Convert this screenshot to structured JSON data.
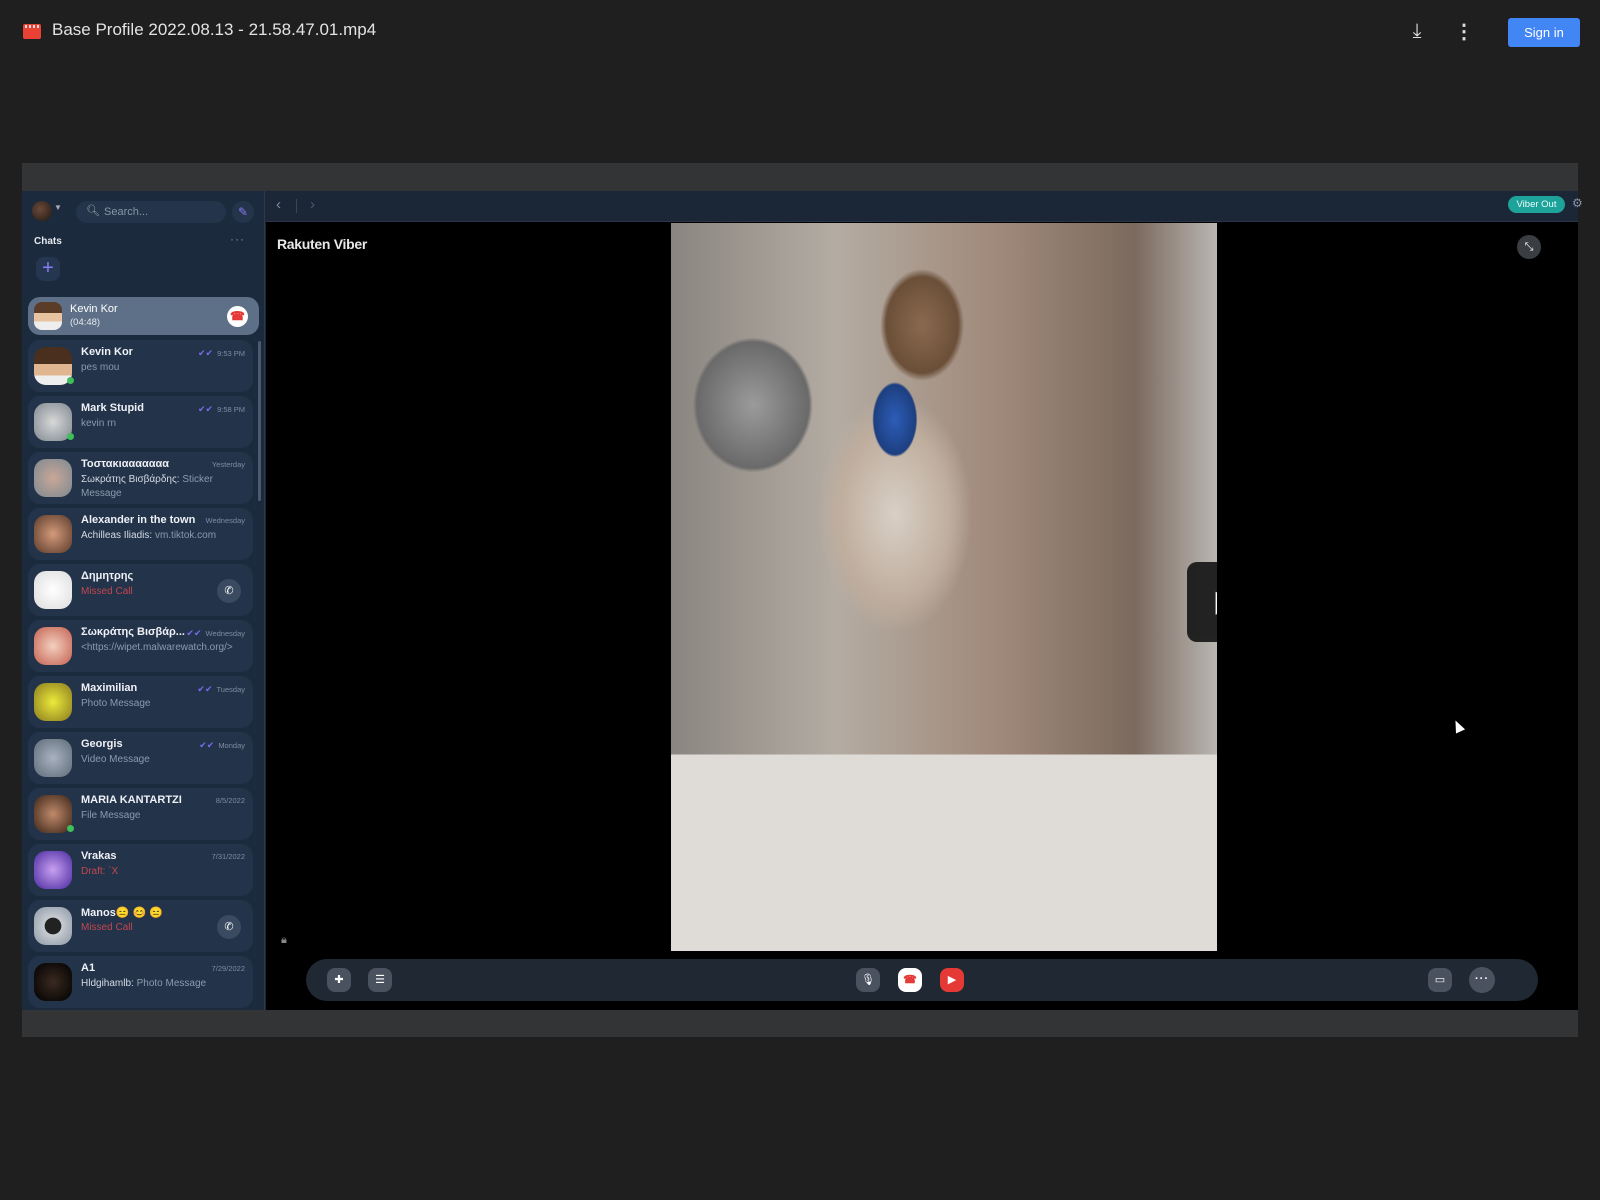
{
  "header": {
    "file_name": "Base Profile 2022.08.13 - 21.58.47.01.mp4",
    "download_label": "Download",
    "more_label": "More actions",
    "sign_in": "Sign in",
    "accent": "#4285f4"
  },
  "viber": {
    "search_placeholder": "Search...",
    "chats_title": "Chats",
    "brand": "Rakuten Viber",
    "viber_out": "Viber Out",
    "active_call": {
      "name": "Kevin Kor",
      "duration": "(04:48)"
    },
    "chats": [
      {
        "name": "Kevin Kor",
        "preview": "pes mou",
        "time": "9:53 PM",
        "read": true,
        "online": true,
        "avatar": "linear-gradient(#4a2e1e 0 45%,#e0b690 45% 75%,#eee 75%)"
      },
      {
        "name": "Mark Stupid",
        "preview": "kevin rn",
        "time": "9:58 PM",
        "read": true,
        "online": true,
        "avatar": "radial-gradient(#d8d8d8,#7f8890)"
      },
      {
        "name": "Τοστακιααααααα",
        "sender": "Σωκράτης Βισβάρδης:",
        "preview": "Sticker Message",
        "time": "Yesterday",
        "avatar": "radial-gradient(#c9a898,#7d8891)"
      },
      {
        "name": "Alexander in the town",
        "sender": "Achilleas Iliadis:",
        "preview": "vm.tiktok.com",
        "time": "Wednesday",
        "avatar": "radial-gradient(#d39a7a,#5a3a2a)"
      },
      {
        "name": "Δημητρης",
        "preview": "Missed Call",
        "missed": true,
        "call": true,
        "avatar": "radial-gradient(#fff,#ddd)"
      },
      {
        "name": "Σωκράτης Βισβάρ...",
        "preview": "<https://wipet.malwarewatch.org/>",
        "time": "Wednesday",
        "read": true,
        "avatar": "radial-gradient(#f3d0bf,#c46050)"
      },
      {
        "name": "Maximilian",
        "preview": "Photo Message",
        "time": "Tuesday",
        "read": true,
        "avatar": "radial-gradient(#ecea3a,#8a7a20)"
      },
      {
        "name": "Georgis",
        "preview": "Video Message",
        "time": "Monday",
        "read": true,
        "avatar": "radial-gradient(#a9b3c0,#5f6b7a)"
      },
      {
        "name": "MARIA KANTARTZI",
        "preview": "File Message",
        "time": "8/5/2022",
        "online": true,
        "avatar": "radial-gradient(#c08a6a,#3a2418)"
      },
      {
        "name": "Vrakas",
        "preview": "Draft: `X",
        "missed": true,
        "time": "7/31/2022",
        "avatar": "radial-gradient(#c8a0f0,#4a2aa0)"
      },
      {
        "name": "Manos😑 😊 😑",
        "preview": "Missed Call",
        "missed": true,
        "call": true,
        "avatar": "radial-gradient(#222 0 30%,#c8ccd2 32%,#8a96a4)"
      },
      {
        "name": "A1",
        "sender": "Hldgihamlb:",
        "preview": "Photo Message",
        "time": "7/29/2022",
        "avatar": "radial-gradient(#3a2a20,#000)"
      }
    ],
    "colors": {
      "viber_out": "#1ea39a",
      "end_call": "#e53935",
      "purple": "#7b6cf0"
    }
  }
}
